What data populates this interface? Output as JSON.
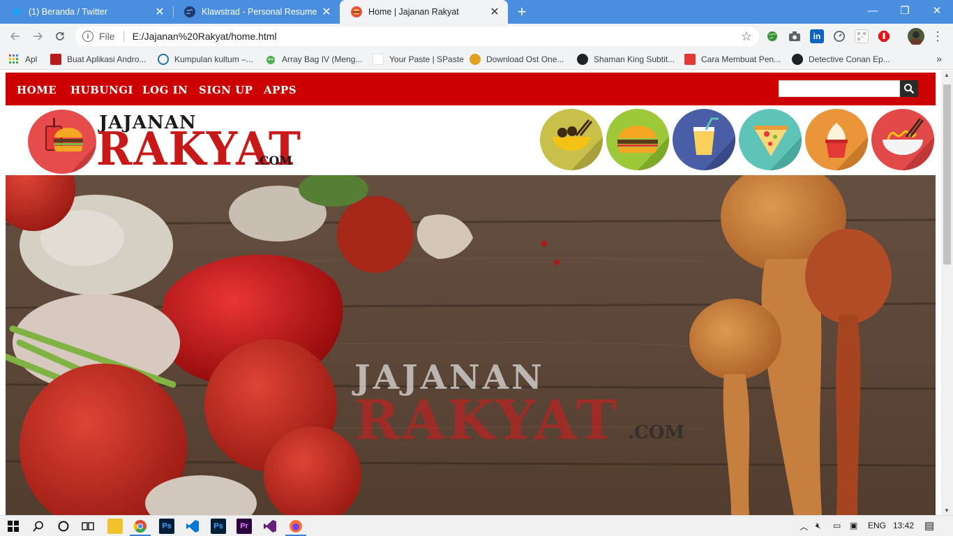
{
  "browser": {
    "tabs": [
      {
        "title": "(1) Beranda / Twitter",
        "icon": "twitter-icon",
        "color": "#1da1f2",
        "active": false
      },
      {
        "title": "Klawstrad - Personal Resume",
        "icon": "globe-icon",
        "color": "#1f3a6e",
        "active": false
      },
      {
        "title": "Home | Jajanan Rakyat",
        "icon": "burger-favicon-icon",
        "color": "#e74c3c",
        "active": true
      }
    ],
    "new_tab": "+",
    "window_controls": {
      "minimize": "—",
      "restore": "❐",
      "close": "✕"
    },
    "address": {
      "scheme": "File",
      "url": "E:/Jajanan%20Rakyat/home.html"
    },
    "bookmarks": [
      {
        "label": "Apl",
        "icon": "apps-grid-icon",
        "color": "#4285f4"
      },
      {
        "label": "Buat Aplikasi Andro...",
        "icon": "bookmark-red-icon",
        "color": "#b71c1c"
      },
      {
        "label": "Kumpulan kultum –...",
        "icon": "wordpress-icon",
        "color": "#21759b"
      },
      {
        "label": "Array Bag IV (Meng...",
        "icon": "alien-icon",
        "color": "#4caf50"
      },
      {
        "label": "Your Paste | SPaste",
        "icon": "paste-icon",
        "color": "#ffffff"
      },
      {
        "label": "Download Ost One...",
        "icon": "music-icon",
        "color": "#e0a020"
      },
      {
        "label": "Shaman King Subtit...",
        "icon": "globe-dark-icon",
        "color": "#202124"
      },
      {
        "label": "Cara Membuat Pen...",
        "icon": "bookmark-c-icon",
        "color": "#e53935"
      },
      {
        "label": "Detective Conan Ep...",
        "icon": "globe-dark-icon",
        "color": "#202124"
      }
    ],
    "bookmarks_more": "»"
  },
  "site": {
    "nav": [
      "HOME",
      "HUBUNGI",
      "LOG IN",
      "SIGN UP",
      "APPS"
    ],
    "search_placeholder": "",
    "logo": {
      "line1": "JAJANAN",
      "line2": "RAKYAT",
      "suffix": ".COM"
    },
    "categories": [
      {
        "name": "noodle-bowl-icon",
        "color": "#c8c04a"
      },
      {
        "name": "burger-icon",
        "color": "#9cc83a"
      },
      {
        "name": "drink-icon",
        "color": "#4a5ea8"
      },
      {
        "name": "pizza-icon",
        "color": "#5ec4b8"
      },
      {
        "name": "ice-cream-icon",
        "color": "#e99538"
      },
      {
        "name": "ramen-icon",
        "color": "#e24a4a"
      }
    ],
    "hero": {
      "line1": "JAJANAN",
      "line2": "RAKYAT",
      "suffix": ".COM"
    }
  },
  "taskbar": {
    "apps": [
      {
        "name": "file-explorer-icon",
        "color": "#f2c12e"
      },
      {
        "name": "chrome-icon",
        "color": "#dd4b39"
      },
      {
        "name": "photoshop-icon",
        "color": "#001e36"
      },
      {
        "name": "vscode-icon",
        "color": "#0078d7"
      },
      {
        "name": "photoshop-2-icon",
        "color": "#001e36"
      },
      {
        "name": "premiere-icon",
        "color": "#2a003f"
      },
      {
        "name": "visual-studio-icon",
        "color": "#68217a"
      },
      {
        "name": "firefox-icon",
        "color": "#ff7139"
      }
    ],
    "language": "ENG",
    "time": "13:42"
  }
}
